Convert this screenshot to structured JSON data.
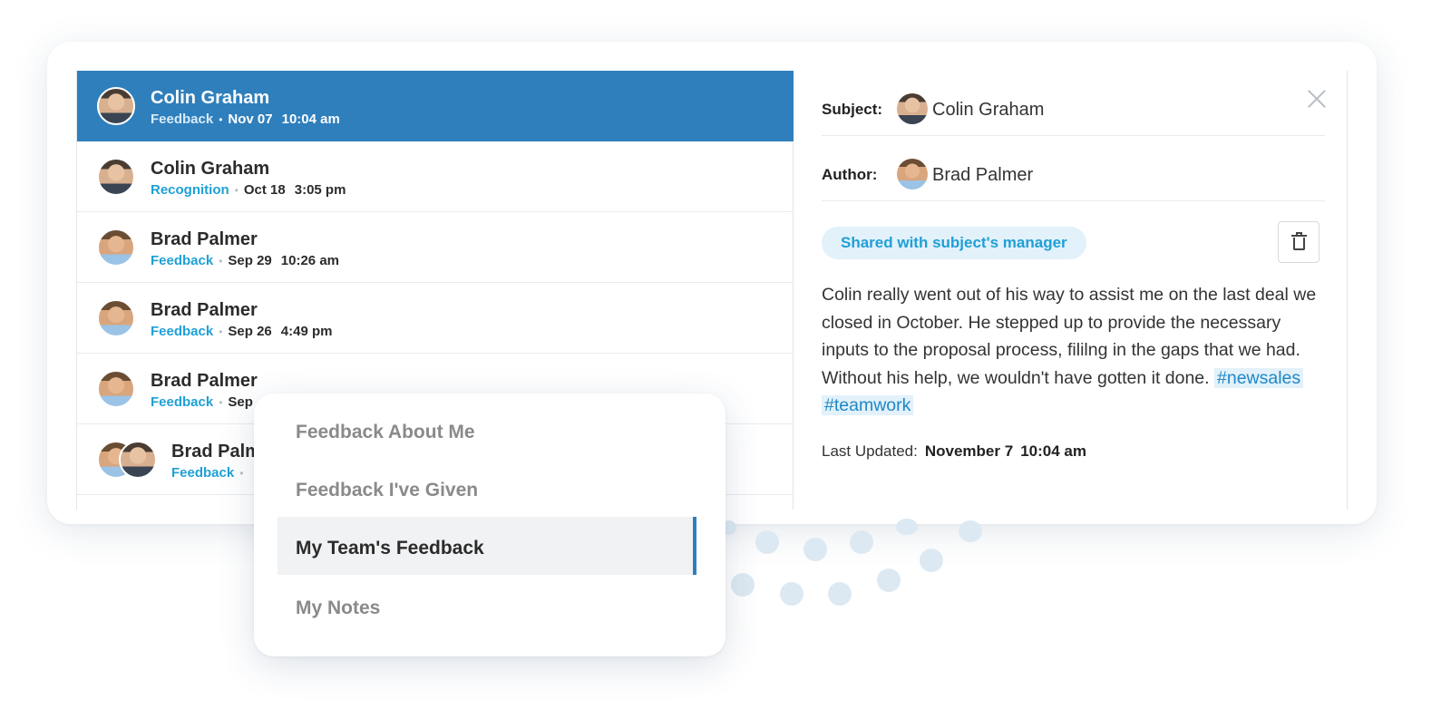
{
  "feedback_list": [
    {
      "name": "Colin Graham",
      "type": "Feedback",
      "date": "Nov 07",
      "time": "10:04 am",
      "selected": true
    },
    {
      "name": "Colin Graham",
      "type": "Recognition",
      "date": "Oct 18",
      "time": "3:05 pm"
    },
    {
      "name": "Brad Palmer",
      "type": "Feedback",
      "date": "Sep 29",
      "time": "10:26 am"
    },
    {
      "name": "Brad Palmer",
      "type": "Feedback",
      "date": "Sep 26",
      "time": "4:49 pm"
    },
    {
      "name": "Brad Palmer",
      "type": "Feedback",
      "date": "Sep"
    },
    {
      "name": "Brad Palm",
      "type": "Feedback"
    }
  ],
  "detail": {
    "subject_label": "Subject:",
    "subject_name": "Colin Graham",
    "author_label": "Author:",
    "author_name": "Brad Palmer",
    "share_badge": "Shared with subject's manager",
    "body": "Colin really went out of his way to assist me on the last deal we closed in October. He stepped up to provide the necessary inputs to the proposal process, fililng in the gaps that we had. Without his help, we wouldn't have gotten it done.",
    "tags": [
      "#newsales",
      "#teamwork"
    ],
    "last_updated_label": "Last Updated:",
    "last_updated_date": "November 7",
    "last_updated_time": "10:04 am"
  },
  "filter_menu": {
    "items": [
      "Feedback About Me",
      "Feedback I've Given",
      "My Team's Feedback",
      "My Notes"
    ],
    "active": "My Team's Feedback"
  },
  "colors": {
    "selected_row": "#2f7fbc",
    "accent": "#1fa0d6",
    "badge_bg": "#e2f1fa"
  },
  "icons": {
    "close": "close-icon",
    "delete": "trash-icon",
    "avatar": "avatar-photo"
  }
}
